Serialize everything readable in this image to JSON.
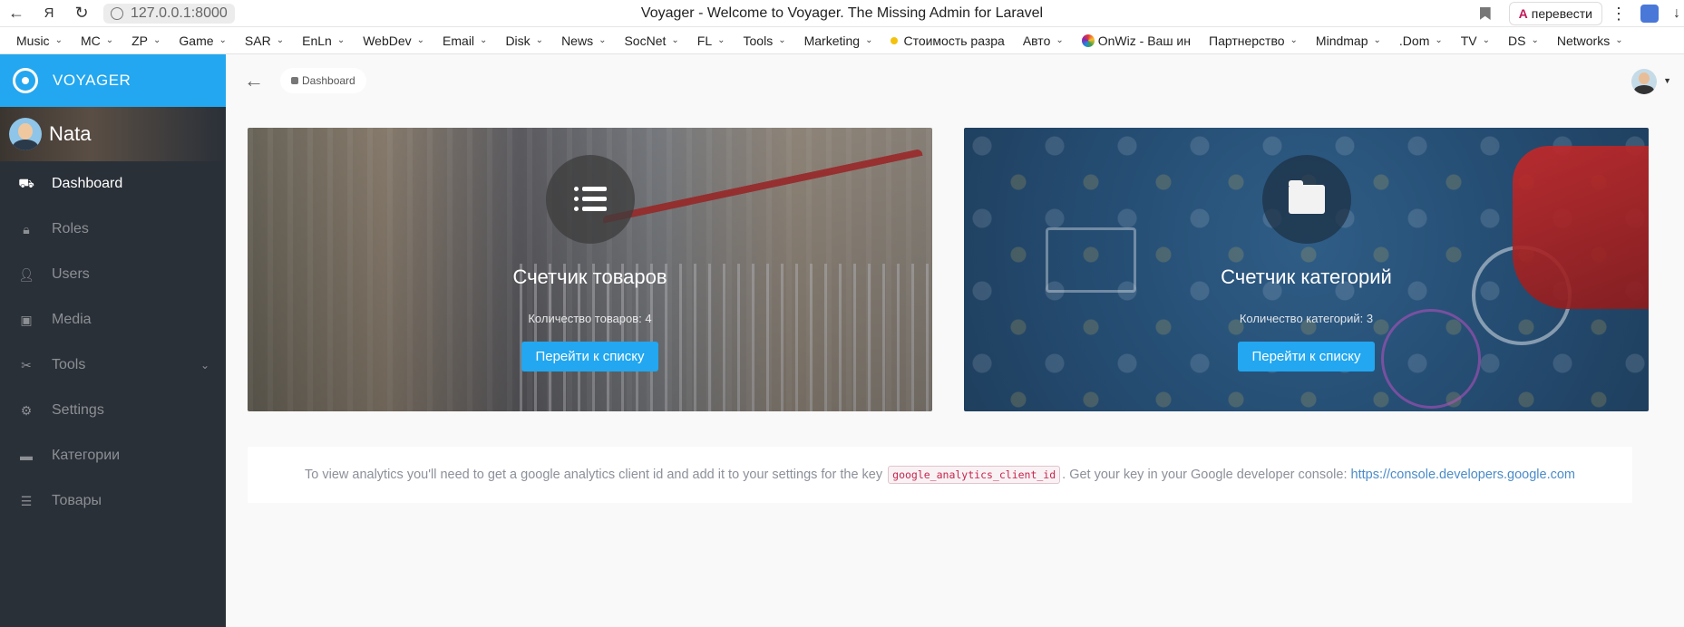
{
  "browser": {
    "url": "127.0.0.1:8000",
    "title": "Voyager - Welcome to Voyager. The Missing Admin for Laravel",
    "translate_label": "перевести",
    "bookmarks": [
      {
        "label": "Music",
        "chevron": true
      },
      {
        "label": "MC",
        "chevron": true
      },
      {
        "label": "ZP",
        "chevron": true
      },
      {
        "label": "Game",
        "chevron": true
      },
      {
        "label": "SAR",
        "chevron": true
      },
      {
        "label": "EnLn",
        "chevron": true
      },
      {
        "label": "WebDev",
        "chevron": true
      },
      {
        "label": "Email",
        "chevron": true
      },
      {
        "label": "Disk",
        "chevron": true
      },
      {
        "label": "News",
        "chevron": true
      },
      {
        "label": "SocNet",
        "chevron": true
      },
      {
        "label": "FL",
        "chevron": true
      },
      {
        "label": "Tools",
        "chevron": true
      },
      {
        "label": "Marketing",
        "chevron": true
      },
      {
        "label": "Стоимость разра",
        "chevron": false
      },
      {
        "label": "Авто",
        "chevron": true
      },
      {
        "label": "OnWiz - Ваш ин",
        "chevron": false
      },
      {
        "label": "Партнерство",
        "chevron": true
      },
      {
        "label": "Mindmap",
        "chevron": true
      },
      {
        "label": ".Dom",
        "chevron": true
      },
      {
        "label": "TV",
        "chevron": true
      },
      {
        "label": "DS",
        "chevron": true
      },
      {
        "label": "Networks",
        "chevron": true
      }
    ]
  },
  "sidebar": {
    "brand": "VOYAGER",
    "user_name": "Nata",
    "items": [
      {
        "label": "Dashboard",
        "icon": "car-icon",
        "active": true
      },
      {
        "label": "Roles",
        "icon": "lock-icon",
        "active": false
      },
      {
        "label": "Users",
        "icon": "person-icon",
        "active": false
      },
      {
        "label": "Media",
        "icon": "image-icon",
        "active": false
      },
      {
        "label": "Tools",
        "icon": "tools-icon",
        "active": false
      },
      {
        "label": "Settings",
        "icon": "gear-icon",
        "active": false
      },
      {
        "label": "Категории",
        "icon": "folder-icon",
        "active": false
      },
      {
        "label": "Товары",
        "icon": "list-icon",
        "active": false
      }
    ]
  },
  "topbar": {
    "breadcrumb": "Dashboard"
  },
  "cards": [
    {
      "title": "Счетчик товаров",
      "subtitle": "Количество товаров: 4",
      "button": "Перейти к списку",
      "icon": "list-icon"
    },
    {
      "title": "Счетчик категорий",
      "subtitle": "Количество категорий: 3",
      "button": "Перейти к списку",
      "icon": "folder-icon"
    }
  ],
  "analytics": {
    "text_before": "To view analytics you'll need to get a google analytics client id and add it to your settings for the key",
    "key": "google_analytics_client_id",
    "text_after": ". Get your key in your Google developer console:",
    "link": "https://console.developers.google.com"
  },
  "colors": {
    "accent": "#22a7f0",
    "sidebar_bg": "#2a3038"
  }
}
